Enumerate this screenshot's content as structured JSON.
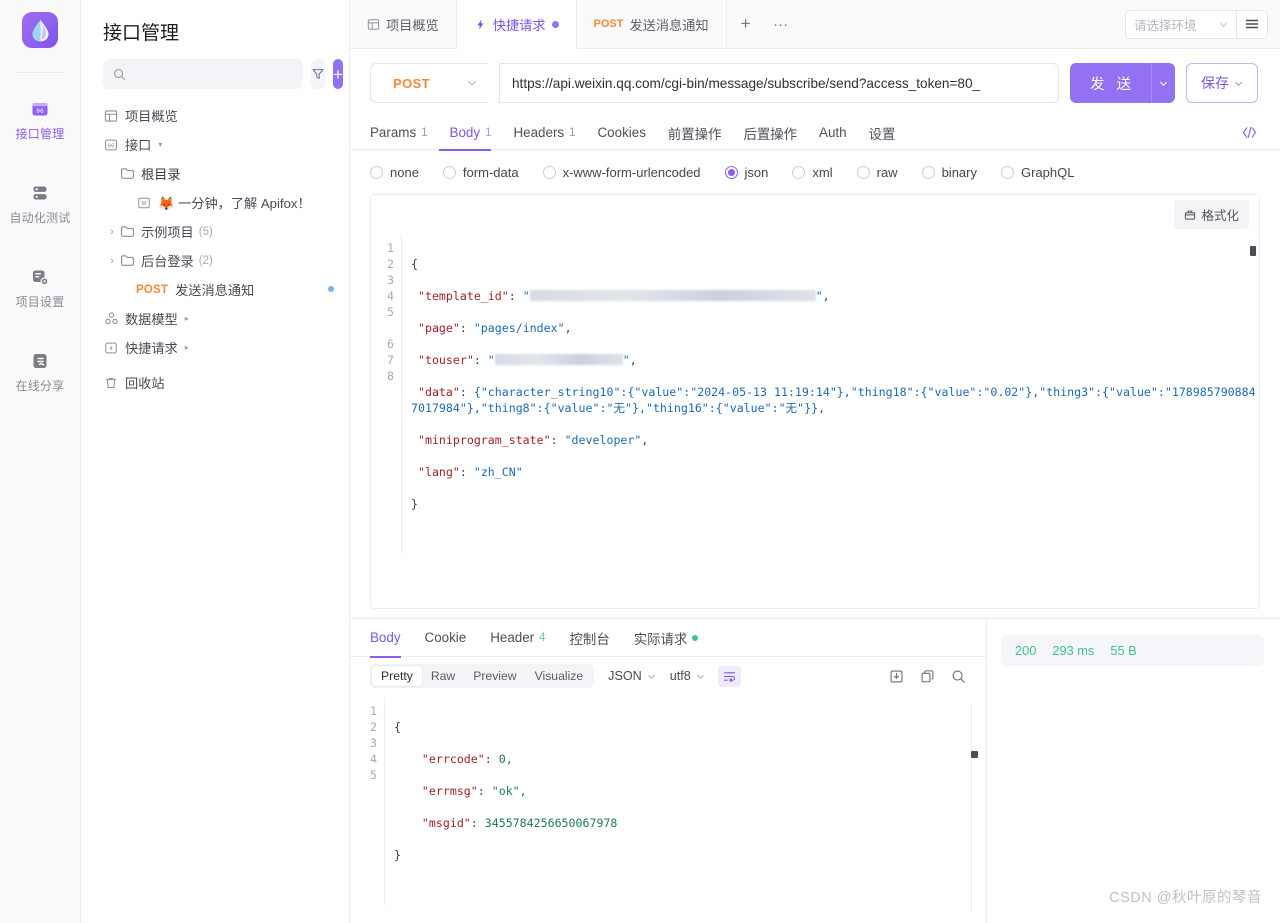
{
  "rail": {
    "logo_name": "apifox-logo",
    "items": [
      {
        "label": "接口管理",
        "icon": "api-management-icon",
        "active": true
      },
      {
        "label": "自动化测试",
        "icon": "automation-test-icon",
        "active": false
      },
      {
        "label": "项目设置",
        "icon": "project-settings-icon",
        "active": false
      },
      {
        "label": "在线分享",
        "icon": "online-share-icon",
        "active": false
      }
    ]
  },
  "sidebar": {
    "title": "接口管理",
    "search_placeholder": "",
    "search_value": "",
    "filter_icon": "filter-icon",
    "add_label": "+",
    "tree": [
      {
        "label": "项目概览",
        "icon": "overview-icon",
        "indent": 0,
        "type": "link"
      },
      {
        "label": "接口",
        "icon": "api-icon",
        "indent": 0,
        "type": "group",
        "caret": "▾"
      },
      {
        "label": "根目录",
        "icon": "folder-icon",
        "indent": 1,
        "type": "folder",
        "highlight": true
      },
      {
        "label": "🦊 一分钟，了解 Apifox！",
        "icon": "markdown-icon",
        "indent": 2,
        "type": "doc"
      },
      {
        "label": "示例项目",
        "icon": "folder-icon",
        "indent": 1,
        "type": "folder",
        "count": "(5)",
        "arrow": "›"
      },
      {
        "label": "后台登录",
        "icon": "folder-icon",
        "indent": 1,
        "type": "folder",
        "count": "(2)",
        "arrow": "›"
      },
      {
        "label": "发送消息通知",
        "method": "POST",
        "indent": 2,
        "type": "endpoint",
        "dot": true
      },
      {
        "label": "数据模型",
        "icon": "datamodel-icon",
        "indent": 0,
        "type": "group",
        "caret": "▸"
      },
      {
        "label": "快捷请求",
        "icon": "quickrequest-icon",
        "indent": 0,
        "type": "group",
        "caret": "▸"
      },
      {
        "label": "回收站",
        "icon": "trash-icon",
        "indent": 0,
        "type": "link"
      }
    ]
  },
  "tabstrip": {
    "tabs": [
      {
        "label": "项目概览",
        "icon": "overview-icon",
        "active": false
      },
      {
        "label": "快捷请求",
        "icon": "bolt-icon",
        "active": true,
        "dirty": true
      },
      {
        "label": "发送消息通知",
        "method": "POST",
        "active": false
      }
    ],
    "add_label": "+",
    "more_label": "···",
    "env_placeholder": "请选择环境",
    "env_menu_icon": "hamburger-icon"
  },
  "urlbar": {
    "method": "POST",
    "url": "https://api.weixin.qq.com/cgi-bin/message/subscribe/send?access_token=80_",
    "send_label": "发 送",
    "save_label": "保存"
  },
  "request": {
    "tabs": [
      {
        "label": "Params",
        "badge": "1",
        "active": false
      },
      {
        "label": "Body",
        "badge": "1",
        "active": true
      },
      {
        "label": "Headers",
        "badge": "1",
        "active": false
      },
      {
        "label": "Cookies",
        "badge": "",
        "active": false
      },
      {
        "label": "前置操作",
        "badge": "",
        "active": false
      },
      {
        "label": "后置操作",
        "badge": "",
        "active": false
      },
      {
        "label": "Auth",
        "badge": "",
        "active": false
      },
      {
        "label": "设置",
        "badge": "",
        "active": false
      }
    ],
    "code_icon": "code-brackets-icon",
    "body_types": [
      {
        "label": "none",
        "selected": false
      },
      {
        "label": "form-data",
        "selected": false
      },
      {
        "label": "x-www-form-urlencoded",
        "selected": false
      },
      {
        "label": "json",
        "selected": true
      },
      {
        "label": "xml",
        "selected": false
      },
      {
        "label": "raw",
        "selected": false
      },
      {
        "label": "binary",
        "selected": false
      },
      {
        "label": "GraphQL",
        "selected": false
      }
    ],
    "format_label": "格式化",
    "editor_lines": [
      "1",
      "2",
      "3",
      "4",
      "5",
      "6",
      "7",
      "8"
    ],
    "json_line1": "{",
    "json_line2_key": "\"template_id\"",
    "json_line3_key": "\"page\"",
    "json_line3_val": "\"pages/index\"",
    "json_line4_key": "\"touser\"",
    "json_line5_key": "\"data\"",
    "json_line5_val": "{\"character_string10\":{\"value\":\"2024-05-13 11:19:14\"},\"thing18\":{\"value\":\"0.02\"},\"thing3\":{\"value\":\"1789857908847017984\"},\"thing8\":{\"value\":\"无\"},\"thing16\":{\"value\":\"无\"}},",
    "json_line6_key": "\"miniprogram_state\"",
    "json_line6_val": "\"developer\"",
    "json_line7_key": "\"lang\"",
    "json_line7_val": "\"zh_CN\"",
    "json_line8": "}"
  },
  "response": {
    "tabs": [
      {
        "label": "Body",
        "badge": "",
        "active": true
      },
      {
        "label": "Cookie",
        "badge": "",
        "active": false
      },
      {
        "label": "Header",
        "badge": "4",
        "active": false
      },
      {
        "label": "控制台",
        "badge": "",
        "active": false
      },
      {
        "label": "实际请求",
        "badge": "",
        "active": false,
        "dot": true
      }
    ],
    "view_segments": [
      {
        "label": "Pretty",
        "active": true
      },
      {
        "label": "Raw",
        "active": false
      },
      {
        "label": "Preview",
        "active": false
      },
      {
        "label": "Visualize",
        "active": false
      }
    ],
    "format_select": "JSON",
    "encoding_select": "utf8",
    "wrap_icon": "wrap-lines-icon",
    "download_icon": "download-icon",
    "copy_icon": "copy-icon",
    "search_icon": "search-icon",
    "lines": [
      "1",
      "2",
      "3",
      "4",
      "5"
    ],
    "r_line1": "{",
    "r_line2_key": "\"errcode\"",
    "r_line2_val": "0,",
    "r_line3_key": "\"errmsg\"",
    "r_line3_val": "\"ok\",",
    "r_line4_key": "\"msgid\"",
    "r_line4_val": "3455784256650067978",
    "r_line5": "}",
    "status_code": "200",
    "status_time": "293 ms",
    "status_size": "55 B"
  },
  "watermark": "CSDN @秋叶原的琴音",
  "colors": {
    "accent": "#8b5cf6",
    "method_post": "#f2893a",
    "success": "#41bf8c"
  }
}
